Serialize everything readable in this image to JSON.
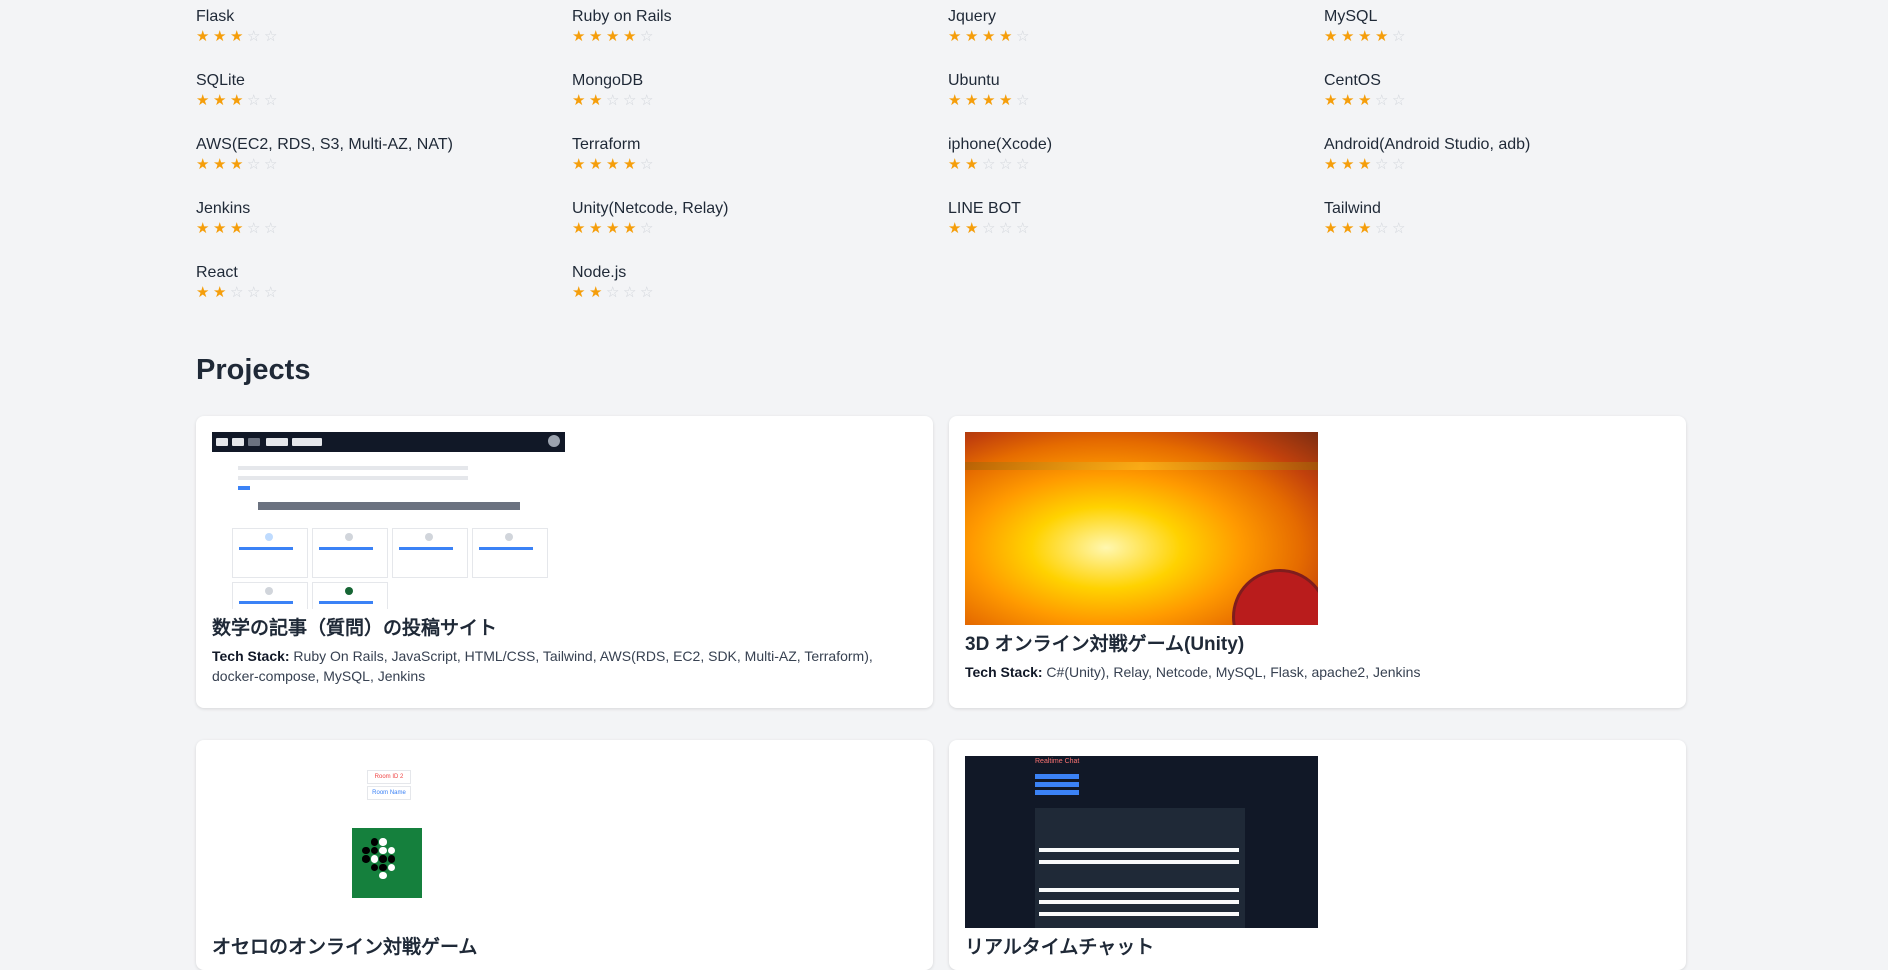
{
  "skills": [
    {
      "name": "Flask",
      "rating": 3
    },
    {
      "name": "Ruby on Rails",
      "rating": 4
    },
    {
      "name": "Jquery",
      "rating": 4
    },
    {
      "name": "MySQL",
      "rating": 4
    },
    {
      "name": "SQLite",
      "rating": 3
    },
    {
      "name": "MongoDB",
      "rating": 2
    },
    {
      "name": "Ubuntu",
      "rating": 4
    },
    {
      "name": "CentOS",
      "rating": 3
    },
    {
      "name": "AWS(EC2, RDS, S3, Multi-AZ, NAT)",
      "rating": 3
    },
    {
      "name": "Terraform",
      "rating": 4
    },
    {
      "name": "iphone(Xcode)",
      "rating": 2
    },
    {
      "name": "Android(Android Studio, adb)",
      "rating": 3
    },
    {
      "name": "Jenkins",
      "rating": 3
    },
    {
      "name": "Unity(Netcode, Relay)",
      "rating": 4
    },
    {
      "name": "LINE BOT",
      "rating": 2
    },
    {
      "name": "Tailwind",
      "rating": 3
    },
    {
      "name": "React",
      "rating": 2
    },
    {
      "name": "Node.js",
      "rating": 2
    }
  ],
  "projects_title": "Projects",
  "tech_label": "Tech Stack:",
  "projects": [
    {
      "title": "数学の記事（質問）の投稿サイト",
      "tech": " Ruby On Rails, JavaScript, HTML/CSS, Tailwind, AWS(RDS, EC2, SDK, Multi-AZ, Terraform), docker-compose, MySQL, Jenkins"
    },
    {
      "title": "3D オンライン対戦ゲーム(Unity)",
      "tech": " C#(Unity), Relay, Netcode, MySQL, Flask, apache2, Jenkins"
    },
    {
      "title": "オセロのオンライン対戦ゲーム",
      "tech": ""
    },
    {
      "title": "リアルタイムチャット",
      "tech": ""
    }
  ],
  "thumb_text": {
    "room_id": "Room ID 2",
    "room_name": "Room Name",
    "chat_title": "Realtime Chat"
  },
  "colors": {
    "star_on": "#f59e0b",
    "star_off": "#d1d5db",
    "background": "#f3f4f6"
  }
}
